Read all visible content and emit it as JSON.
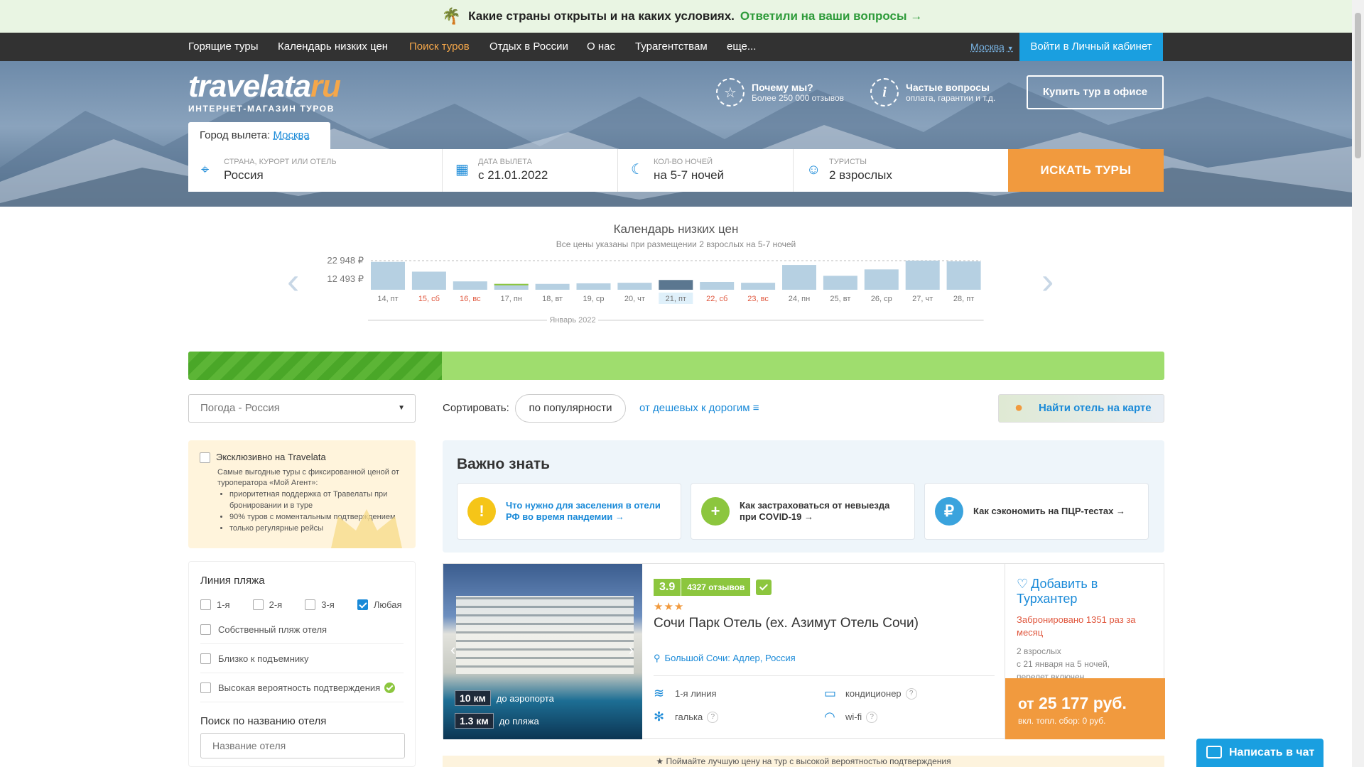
{
  "promo": {
    "icon": "palm-icon",
    "text": "Какие страны открыты и на каких условиях.",
    "link": "Ответили на ваши вопросы"
  },
  "nav": {
    "items": [
      {
        "label": "Горящие туры",
        "active": false
      },
      {
        "label": "Календарь низких цен",
        "active": false
      },
      {
        "label": "Поиск туров",
        "active": true
      },
      {
        "label": "Отдых в России",
        "active": false
      },
      {
        "label": "О нас",
        "active": false
      },
      {
        "label": "Турагентствам",
        "active": false
      },
      {
        "label": "еще...",
        "active": false
      }
    ],
    "city": "Москва",
    "login": "Войти в Личный кабинет"
  },
  "header": {
    "logo_main": "travelata",
    "logo_tld": "ru",
    "logo_sub": "ИНТЕРНЕТ-МАГАЗИН ТУРОВ",
    "why_title": "Почему мы?",
    "why_sub": "Более 250 000 отзывов",
    "faq_title": "Частые вопросы",
    "faq_sub": "оплата, гарантии и т.д.",
    "office_btn": "Купить тур в офисе"
  },
  "search": {
    "city_label": "Город вылета:",
    "city_value": "Москва",
    "dest_label": "Страна, курорт или отель",
    "dest_value": "Россия",
    "date_label": "Дата вылета",
    "date_value": "с 21.01.2022",
    "nights_label": "Кол-во ночей",
    "nights_value": "на 5-7 ночей",
    "tourists_label": "Туристы",
    "tourists_value": "2 взрослых",
    "button": "ИСКАТЬ ТУРЫ"
  },
  "calendar": {
    "title": "Календарь низких цен",
    "subtitle": "Все цены указаны при размещении 2 взрослых на 5-7 ночей",
    "month": "Январь 2022"
  },
  "chart_data": {
    "type": "bar",
    "categories": [
      "14, пт",
      "15, сб",
      "16, вс",
      "17, пн",
      "18, вт",
      "19, ср",
      "20, чт",
      "21, пт",
      "22, сб",
      "23, вс",
      "24, пн",
      "25, вт",
      "26, ср",
      "27, чт",
      "28, пт"
    ],
    "weekend": [
      false,
      true,
      true,
      false,
      false,
      false,
      false,
      false,
      true,
      true,
      false,
      false,
      false,
      false,
      false
    ],
    "selected_index": 7,
    "values": [
      22500,
      19000,
      15500,
      14600,
      14600,
      14800,
      15000,
      16000,
      15300,
      15000,
      21400,
      17500,
      19800,
      22948,
      22700
    ],
    "yticks": [
      "22 948 ₽",
      "12 493 ₽"
    ],
    "ylim": [
      12493,
      22948
    ],
    "colors": {
      "bar": "#b6d0e2",
      "selected": "#5b7790",
      "min_marker": "#8cc63e",
      "weekend_label": "#e0583f",
      "label": "#777"
    }
  },
  "progress": {
    "fraction": 0.26
  },
  "filters": {
    "weather_select": "Погода - Россия",
    "sort_label": "Сортировать:",
    "sort_popular": "по популярности",
    "sort_cheap": "от дешевых к дорогим",
    "map_button": "Найти отель на карте",
    "exclusive_title": "Эксклюзивно на Travelata",
    "exclusive_text": "Самые выгодные туры с фиксированной ценой от туроператора «Мой Агент»:",
    "exclusive_points": [
      "приоритетная поддержка от Травелаты при бронировании и в туре",
      "90% туров с моментальным подтверждением",
      "только регулярные рейсы"
    ],
    "beach_title": "Линия пляжа",
    "beach_options": [
      {
        "label": "1-я",
        "checked": false
      },
      {
        "label": "2-я",
        "checked": false
      },
      {
        "label": "3-я",
        "checked": false
      },
      {
        "label": "Любая",
        "checked": true
      }
    ],
    "checks": [
      "Собственный пляж отеля",
      "Близко к подъемнику",
      "Высокая вероятность подтверждения"
    ],
    "hotel_search_title": "Поиск по названию отеля",
    "hotel_search_placeholder": "Название отеля"
  },
  "important": {
    "title": "Важно знать",
    "cards": [
      {
        "icon": "exclamation-icon",
        "color": "#f5c518",
        "glyph": "!",
        "text": "Что нужно для заселения в отели РФ во время пандемии →",
        "link": true
      },
      {
        "icon": "plus-icon",
        "color": "#8cc63e",
        "glyph": "+",
        "text": "Как застраховаться от невыезда при COVID-19 →",
        "link": false
      },
      {
        "icon": "ruble-icon",
        "color": "#3aa3dd",
        "glyph": "₽",
        "text": "Как сэкономить на ПЦР-тестах →",
        "link": false
      }
    ]
  },
  "hotel": {
    "rating": "3.9",
    "reviews": "4327 отзывов",
    "stars": "★★★",
    "name": "Сочи Парк Отель (ех. Азимут Отель Сочи)",
    "location": "Большой Сочи: Адлер, Россия",
    "dist_airport_value": "10 км",
    "dist_airport_label": "до аэропорта",
    "dist_beach_value": "1.3 км",
    "dist_beach_label": "до пляжа",
    "features": [
      {
        "icon": "beach-icon",
        "label": "1-я линия",
        "help": false
      },
      {
        "icon": "aircon-icon",
        "label": "кондиционер",
        "help": true
      },
      {
        "icon": "pebble-icon",
        "label": "галька",
        "help": true
      },
      {
        "icon": "wifi-icon",
        "label": "wi-fi",
        "help": true
      }
    ],
    "favorite": "Добавить в Турхантер",
    "booked": "Забронировано 1351 раз за месяц",
    "tourists": "2 взрослых",
    "dates": "с 21 января на 5 ночей,",
    "flight": "перелет включен",
    "price_prefix": "от",
    "price": "25 177 руб.",
    "fuel": "вкл. топл. сбор: 0 руб."
  },
  "tip": "Поймайте лучшую цену на тур с высокой вероятностью подтверждения",
  "chat": "Написать в чат"
}
